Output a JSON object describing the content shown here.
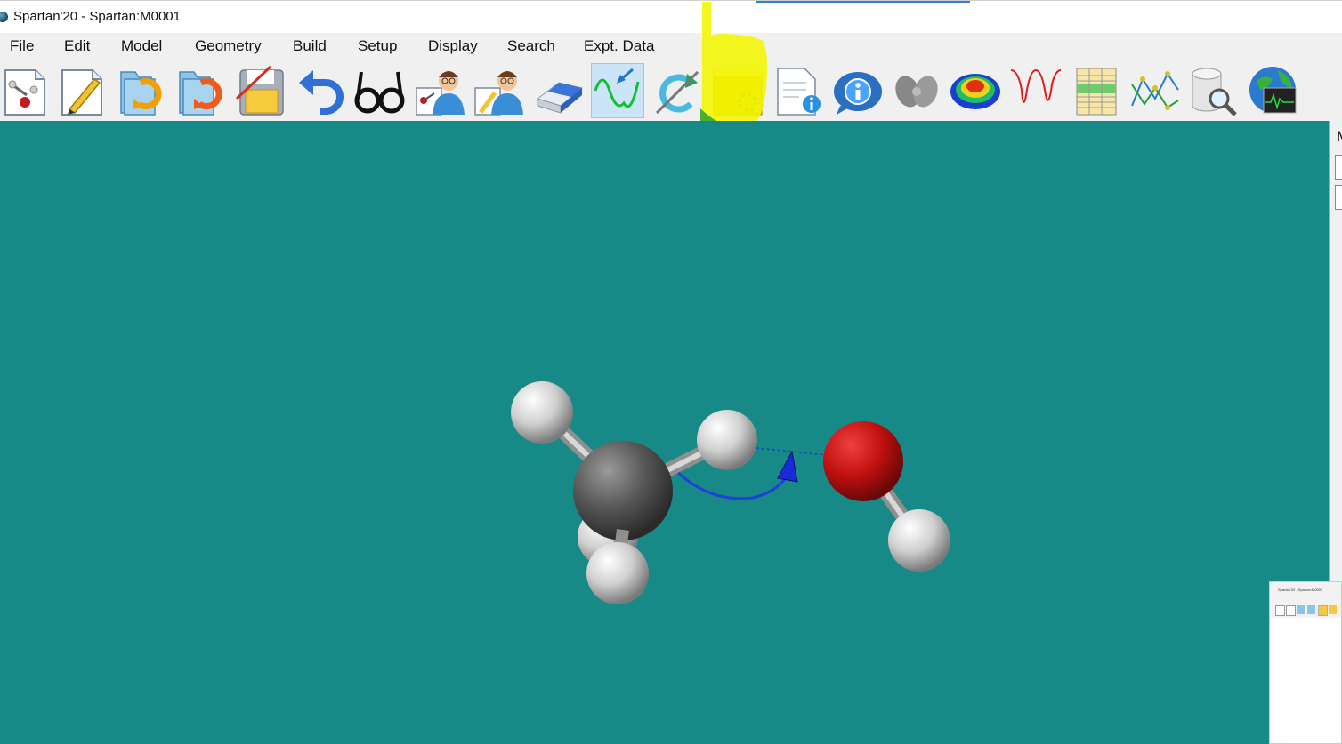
{
  "window": {
    "title": "Spartan'20 - Spartan:M0001"
  },
  "menu": [
    {
      "first": "F",
      "rest": "ile"
    },
    {
      "first": "E",
      "rest": "dit"
    },
    {
      "first": "M",
      "rest": "odel"
    },
    {
      "first": "G",
      "rest": "eometry"
    },
    {
      "first": "B",
      "rest": "uild"
    },
    {
      "first": "S",
      "rest": "etup"
    },
    {
      "first": "D",
      "rest": "isplay"
    },
    {
      "first": "",
      "rest": "Search",
      "underline_index": 3
    },
    {
      "first": "",
      "rest": "Expt. Data",
      "underline_index": 8
    }
  ],
  "menu_display": {
    "search_a": "Sea",
    "search_u": "r",
    "search_b": "ch",
    "expt_a": "Expt. Da",
    "expt_u": "t",
    "expt_b": "a"
  },
  "toolbar": {
    "buttons": [
      "new-molecule-icon",
      "build-pencil-icon",
      "open-folder-icon",
      "recent-folder-icon",
      "close-save-icon",
      "save-disk-icon",
      "undo-arrow-icon",
      "view-glasses-icon",
      "builder-person-icon",
      "editor-person-icon",
      "eraser-icon",
      "reaction-coordinate-icon",
      "rotate-refresh-icon",
      "calculations-settings-icon",
      "output-document-icon",
      "properties-info-icon",
      "orbitals-icon",
      "surfaces-icon",
      "spectra-icon",
      "spreadsheet-icon",
      "plots-icon",
      "database-search-icon",
      "monitor-globe-icon"
    ],
    "active": "reaction-coordinate-icon",
    "highlighted": "calculations-settings-icon"
  },
  "colors": {
    "viewport_bg": "#178a87",
    "highlight": "#f3f500",
    "hydrogen": "#d9d9d9",
    "carbon": "#555555",
    "oxygen": "#c01010",
    "arrow": "#2030d0"
  },
  "right_panel": {
    "label": "M"
  },
  "thumbnail": {
    "title": "Spartan'20 - Spartan:M0001"
  }
}
